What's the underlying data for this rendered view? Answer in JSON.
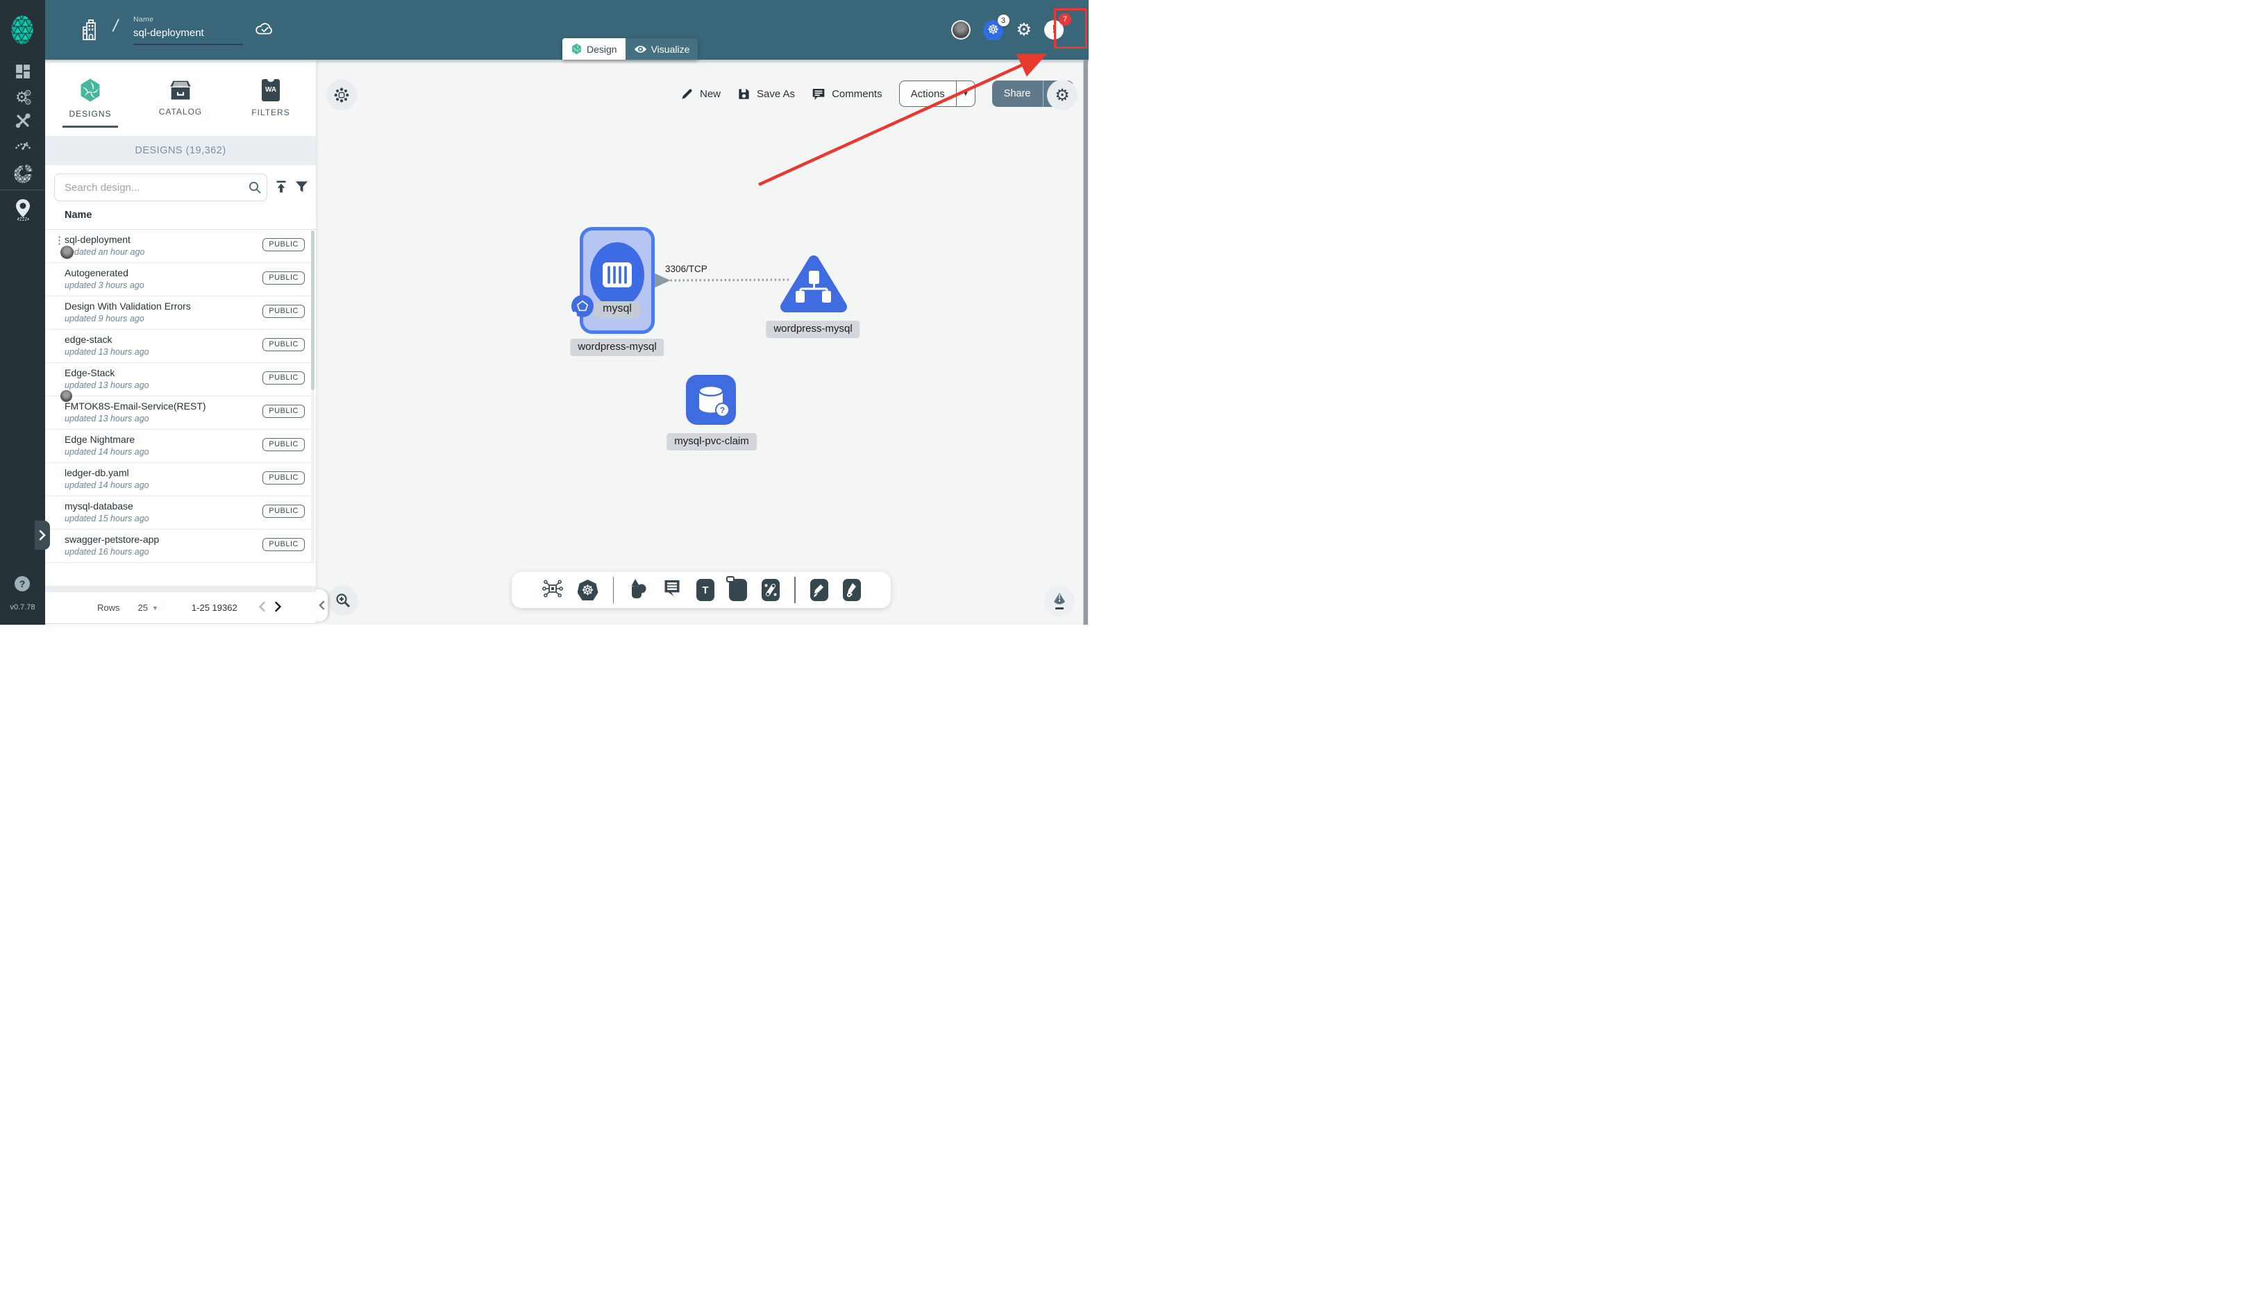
{
  "header": {
    "name_label": "Name",
    "name_value": "sql-deployment",
    "k8s_badge": "3",
    "notif_badge": "7",
    "tabs": {
      "design": "Design",
      "visualize": "Visualize"
    }
  },
  "sidebar": {
    "version": "v0.7.78"
  },
  "panel": {
    "tabs": [
      {
        "label": "DESIGNS"
      },
      {
        "label": "CATALOG"
      },
      {
        "label": "FILTERS",
        "icon_text": "WA"
      }
    ],
    "section_header": "DESIGNS (19,362)",
    "search_placeholder": "Search design...",
    "column_name": "Name",
    "rows": [
      {
        "name": "sql-deployment",
        "updated": "updated an hour ago",
        "badge": "PUBLIC"
      },
      {
        "name": "Autogenerated",
        "updated": "updated 3 hours ago",
        "badge": "PUBLIC"
      },
      {
        "name": "Design With Validation Errors",
        "updated": "updated 9 hours ago",
        "badge": "PUBLIC"
      },
      {
        "name": "edge-stack",
        "updated": "updated 13 hours ago",
        "badge": "PUBLIC"
      },
      {
        "name": "Edge-Stack",
        "updated": "updated 13 hours ago",
        "badge": "PUBLIC"
      },
      {
        "name": "FMTOK8S-Email-Service(REST)",
        "updated": "updated 13 hours ago",
        "badge": "PUBLIC"
      },
      {
        "name": "Edge Nightmare",
        "updated": "updated 14 hours ago",
        "badge": "PUBLIC"
      },
      {
        "name": "ledger-db.yaml",
        "updated": "updated 14 hours ago",
        "badge": "PUBLIC"
      },
      {
        "name": "mysql-database",
        "updated": "updated 15 hours ago",
        "badge": "PUBLIC"
      },
      {
        "name": "swagger-petstore-app",
        "updated": "updated 16 hours ago",
        "badge": "PUBLIC"
      }
    ],
    "pagination": {
      "rows_label": "Rows",
      "per_page": "25",
      "range": "1-25 19362"
    }
  },
  "canvas": {
    "toolbar": {
      "new": "New",
      "save_as": "Save As",
      "comments": "Comments",
      "actions": "Actions",
      "share": "Share"
    },
    "edge_label": "3306/TCP",
    "nodes": {
      "deployment": {
        "chip": "mysql",
        "label": "wordpress-mysql"
      },
      "service": {
        "label": "wordpress-mysql"
      },
      "pvc": {
        "label": "mysql-pvc-claim"
      }
    }
  },
  "icons": {
    "kebab": "⋮",
    "help_glyph": "?",
    "alert_glyph": "!",
    "helm_glyph": "☸",
    "gear_glyph": "⚙",
    "caret_down": "▼",
    "text_tool": "T"
  },
  "colors": {
    "header_teal": "#396679",
    "accent_green": "#00B39F",
    "node_blue": "#3F6CE0",
    "annotation_red": "#E8392E"
  }
}
